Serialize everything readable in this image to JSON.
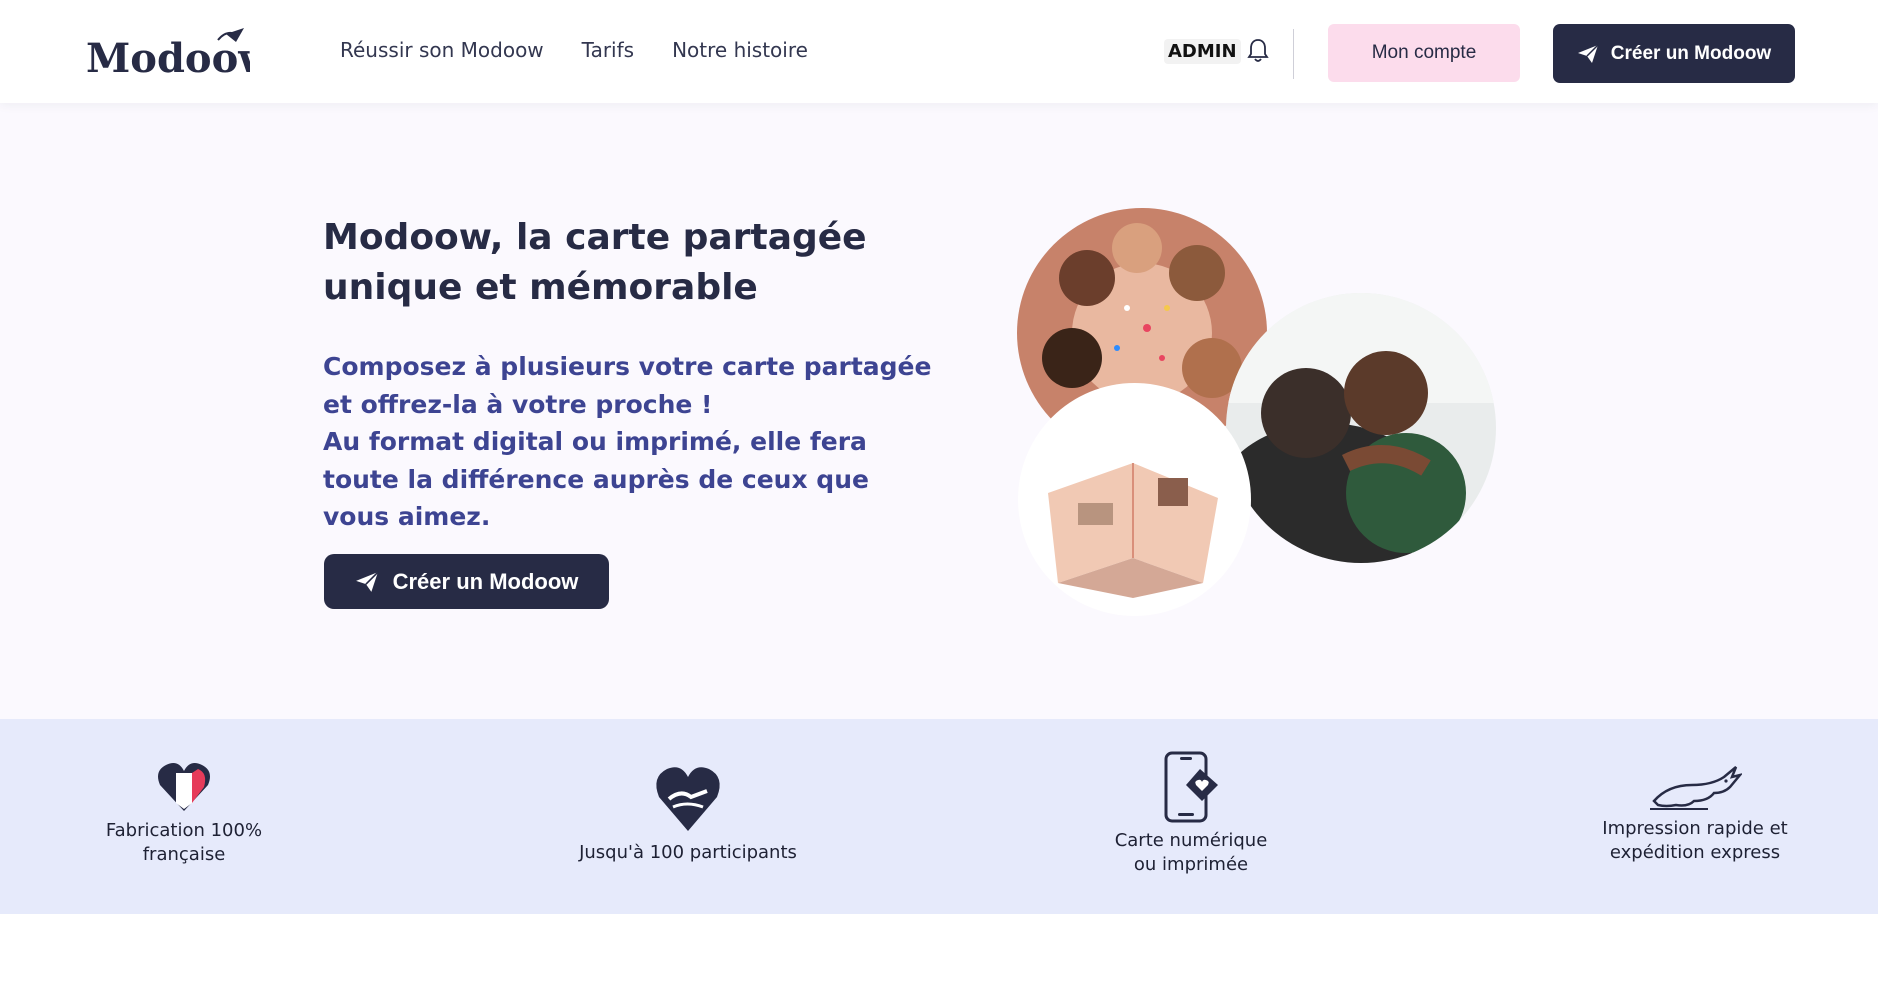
{
  "header": {
    "logo_text": "Modoow",
    "nav": [
      "Réussir son Modoow",
      "Tarifs",
      "Notre histoire"
    ],
    "admin_label": "ADMIN",
    "account_button": "Mon compte",
    "create_button": "Créer un Modoow"
  },
  "hero": {
    "title": "Modoow, la carte partagée unique et mémorable",
    "subtitle_line1": "Composez à plusieurs votre carte partagée et offrez-la à votre proche !",
    "subtitle_line2": "Au format digital ou imprimé, elle fera toute la différence auprès de ceux que vous aimez.",
    "cta": "Créer un Modoow"
  },
  "features": [
    {
      "label": "Fabrication 100% française",
      "icon": "france-heart-icon"
    },
    {
      "label": "Jusqu'à 100 participants",
      "icon": "hands-heart-icon"
    },
    {
      "label": "Carte numérique ou imprimée",
      "icon": "phone-card-icon"
    },
    {
      "label": "Impression rapide et expédition express",
      "icon": "rabbit-icon"
    }
  ],
  "colors": {
    "navy": "#272b45",
    "pink": "#fcdcec",
    "subtitle_blue": "#3d4492",
    "features_bg": "#e6eafb",
    "hero_bg": "#fbf9fe"
  }
}
